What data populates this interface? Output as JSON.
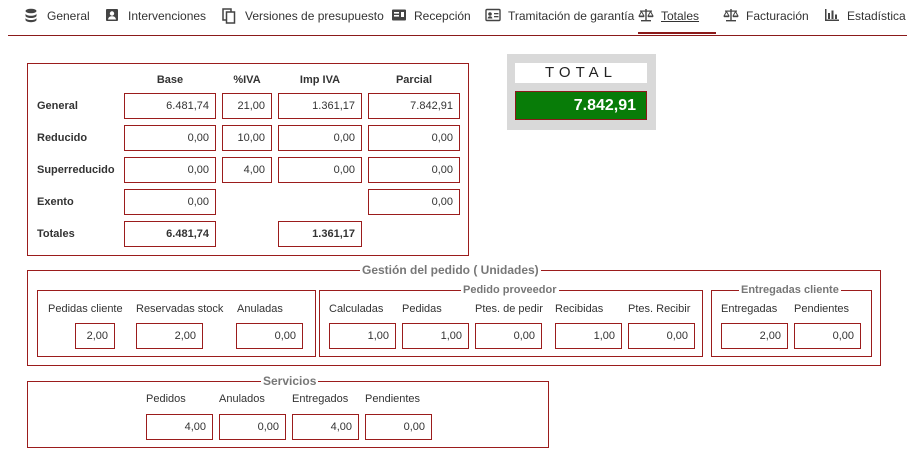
{
  "tabs": [
    {
      "label": "General",
      "icon": "database-icon"
    },
    {
      "label": "Intervenciones",
      "icon": "person-card-icon"
    },
    {
      "label": "Versiones de presupuesto",
      "icon": "copy-icon"
    },
    {
      "label": "Recepción",
      "icon": "id-card-icon"
    },
    {
      "label": "Tramitación de garantía",
      "icon": "contact-card-icon"
    },
    {
      "label": "Totales",
      "icon": "scale-icon",
      "active": true
    },
    {
      "label": "Facturación",
      "icon": "scale-icon"
    },
    {
      "label": "Estadística",
      "icon": "bar-chart-icon"
    }
  ],
  "taxes": {
    "headers": {
      "base": "Base",
      "iva": "%IVA",
      "imp_iva": "Imp IVA",
      "parcial": "Parcial"
    },
    "rows": [
      {
        "label": "General",
        "base": "6.481,74",
        "iva": "21,00",
        "imp_iva": "1.361,17",
        "parcial": "7.842,91"
      },
      {
        "label": "Reducido",
        "base": "0,00",
        "iva": "10,00",
        "imp_iva": "0,00",
        "parcial": "0,00"
      },
      {
        "label": "Superreducido",
        "base": "0,00",
        "iva": "4,00",
        "imp_iva": "0,00",
        "parcial": "0,00"
      },
      {
        "label": "Exento",
        "base": "0,00",
        "parcial": "0,00"
      }
    ],
    "totales": {
      "label": "Totales",
      "base": "6.481,74",
      "imp_iva": "1.361,17"
    }
  },
  "total": {
    "title": "TOTAL",
    "value": "7.842,91"
  },
  "gestion": {
    "title": "Gestión del pedido ( Unidades)",
    "cliente": {
      "labels": [
        "Pedidas cliente",
        "Reservadas stock",
        "Anuladas"
      ],
      "values": [
        "2,00",
        "2,00",
        "0,00"
      ]
    },
    "proveedor": {
      "title": "Pedido proveedor",
      "labels": [
        "Calculadas",
        "Pedidas",
        "Ptes. de pedir",
        "Recibidas",
        "Ptes. Recibir"
      ],
      "values": [
        "1,00",
        "1,00",
        "0,00",
        "1,00",
        "0,00"
      ]
    },
    "entregadas": {
      "title": "Entregadas cliente",
      "labels": [
        "Entregadas",
        "Pendientes"
      ],
      "values": [
        "2,00",
        "0,00"
      ]
    }
  },
  "servicios": {
    "title": "Servicios",
    "labels": [
      "Pedidos",
      "Anulados",
      "Entregados",
      "Pendientes"
    ],
    "values": [
      "4,00",
      "0,00",
      "4,00",
      "0,00"
    ]
  }
}
